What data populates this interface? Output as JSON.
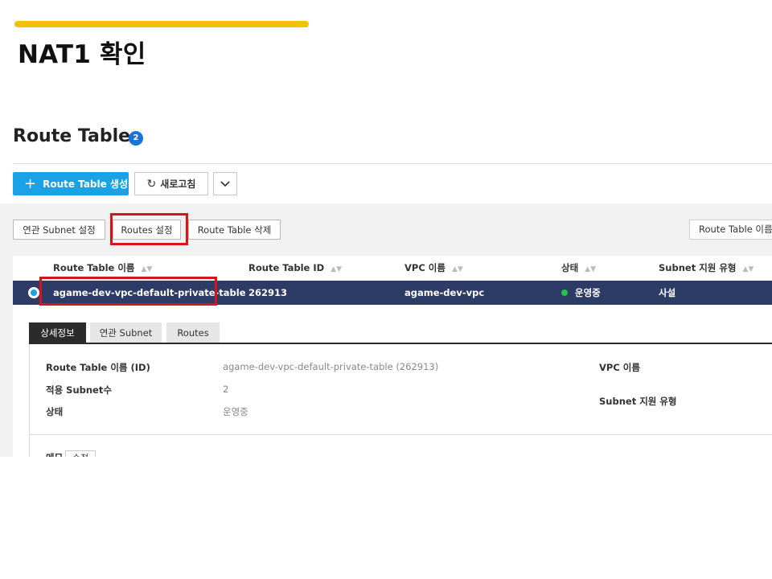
{
  "slide": {
    "title": "NAT1 확인",
    "accent_color": "#f5c000"
  },
  "page": {
    "title": "Route Table",
    "badge": "2"
  },
  "toolbar": {
    "create_label": "Route Table 생성",
    "create_icon": "plus-icon",
    "refresh_label": "새로고침",
    "refresh_icon": "refresh-icon",
    "more_icon": "chevron-down-icon"
  },
  "actions": {
    "subnet_label": "연관 Subnet 설정",
    "routes_label": "Routes 설정",
    "delete_label": "Route Table 삭제",
    "search_placeholder": "Route Table 이름"
  },
  "table": {
    "columns": [
      "Route Table 이름",
      "Route Table ID",
      "VPC 이름",
      "상태",
      "Subnet 지원 유형"
    ],
    "rows": [
      {
        "selected": true,
        "name": "agame-dev-vpc-default-private-table",
        "id": "262913",
        "vpc": "agame-dev-vpc",
        "status": "운영중",
        "status_color": "#27c24c",
        "subnet_type": "사설"
      }
    ]
  },
  "detail": {
    "tabs": [
      "상세정보",
      "연관 Subnet",
      "Routes"
    ],
    "active_tab": "상세정보",
    "fields": [
      {
        "label": "Route Table 이름 (ID)",
        "value": "agame-dev-vpc-default-private-table (262913)"
      },
      {
        "label": "적용 Subnet수",
        "value": "2"
      },
      {
        "label": "상태",
        "value": "운영중"
      }
    ],
    "right_fields": [
      {
        "label": "VPC 이름",
        "value": ""
      },
      {
        "label": "Subnet 지원 유형",
        "value": ""
      }
    ],
    "memo_label": "메모",
    "memo_button": "수정"
  },
  "highlight_color": "#d6141a"
}
